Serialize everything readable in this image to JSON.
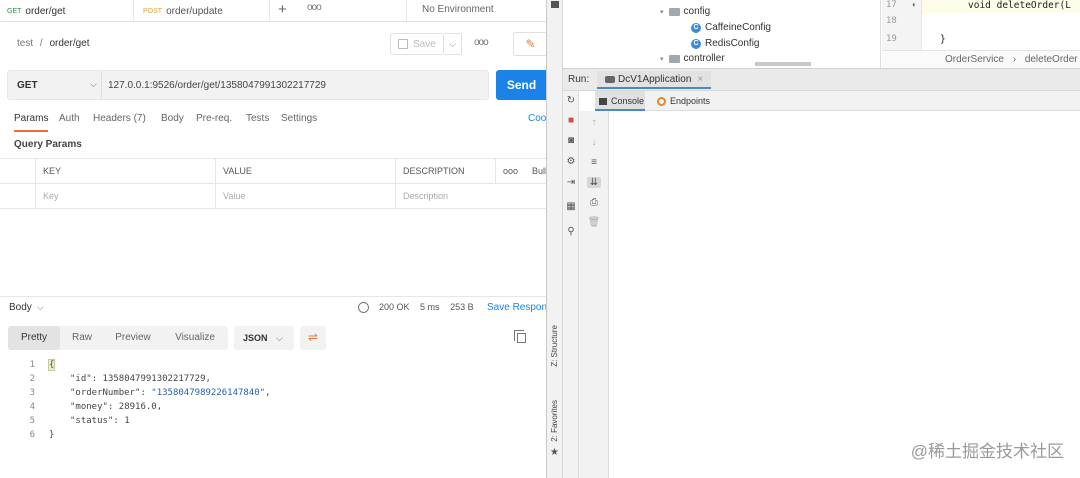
{
  "postman": {
    "tabs": [
      {
        "method": "GET",
        "name": "order/get"
      },
      {
        "method": "POST",
        "name": "order/update"
      }
    ],
    "new_tab": "+",
    "more": "ooo",
    "environment": "No Environment",
    "breadcrumb": {
      "collection": "test",
      "separator": "/",
      "request": "order/get"
    },
    "save_label": "Save",
    "request": {
      "method": "GET",
      "url": "127.0.0.1:9526/order/get/1358047991302217729"
    },
    "send_label": "Send",
    "request_tabs": [
      "Params",
      "Auth",
      "Headers (7)",
      "Body",
      "Pre-req.",
      "Tests",
      "Settings"
    ],
    "cookies_label": "Cookies",
    "query_params_title": "Query Params",
    "params_headers": {
      "key": "KEY",
      "value": "VALUE",
      "description": "DESCRIPTION",
      "bulk": "Bulk Edit"
    },
    "params_placeholders": {
      "key": "Key",
      "value": "Value",
      "description": "Description"
    },
    "response": {
      "body_label": "Body",
      "status": "200 OK",
      "time": "5 ms",
      "size": "253 B",
      "save_label": "Save Response",
      "view_tabs": [
        "Pretty",
        "Raw",
        "Preview",
        "Visualize"
      ],
      "format": "JSON",
      "lines": [
        {
          "n": "1",
          "text": "{"
        },
        {
          "n": "2",
          "key": "\"id\"",
          "sep": ": ",
          "val": "1358047991302217729",
          "end": ","
        },
        {
          "n": "3",
          "key": "\"orderNumber\"",
          "sep": ": ",
          "str": "\"1358047989226147840\"",
          "end": ","
        },
        {
          "n": "4",
          "key": "\"money\"",
          "sep": ": ",
          "val": "28916.0",
          "end": ","
        },
        {
          "n": "5",
          "key": "\"status\"",
          "sep": ": ",
          "val": "1",
          "end": ""
        },
        {
          "n": "6",
          "text": "}"
        }
      ]
    }
  },
  "ide": {
    "tree": [
      {
        "label": "config",
        "kind": "folder"
      },
      {
        "label": "CaffeineConfig",
        "kind": "class"
      },
      {
        "label": "RedisConfig",
        "kind": "class"
      },
      {
        "label": "controller",
        "kind": "folder"
      }
    ],
    "editor": {
      "line_numbers": [
        "17",
        "18",
        "19"
      ],
      "code": [
        "void deleteOrder(L",
        "",
        "}"
      ],
      "breadcrumbs": [
        "OrderService",
        "deleteOrder"
      ]
    },
    "run_label": "Run:",
    "run_config": "DcV1Application",
    "close": "×",
    "subtabs": [
      "Console",
      "Endpoints"
    ],
    "side_tabs": [
      "Z: Structure",
      "2: Favorites"
    ]
  },
  "watermark": "@稀土掘金技术社区",
  "colors": {
    "send": "#1b83e8",
    "accent": "#f26b3a",
    "ide_tab": "#4a88c7"
  }
}
